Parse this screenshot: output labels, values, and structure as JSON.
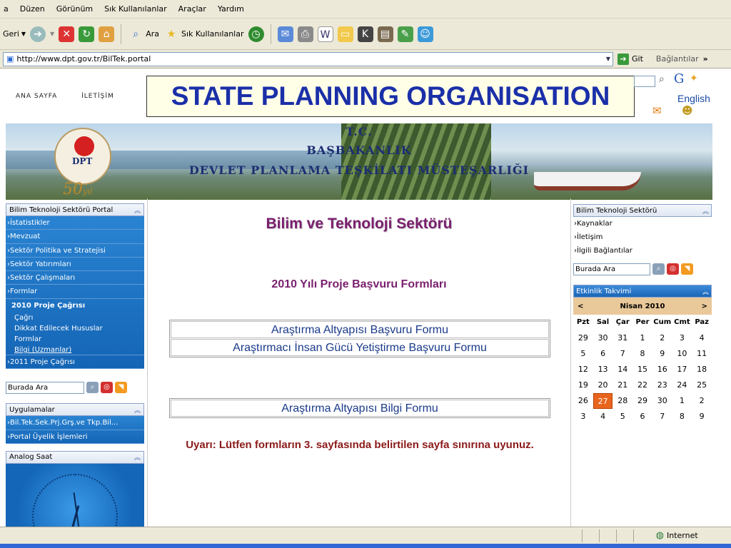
{
  "browser": {
    "menu": [
      "a",
      "Düzen",
      "Görünüm",
      "Sık Kullanılanlar",
      "Araçlar",
      "Yardım"
    ],
    "toolbar": {
      "back": "Geri",
      "search": "Ara",
      "favorites": "Sık Kullanılanlar"
    },
    "address": {
      "url": "http://www.dpt.gov.tr/BilTek.portal",
      "go": "Git",
      "links": "Bağlantılar"
    },
    "status": {
      "zone": "Internet"
    }
  },
  "page": {
    "toplinks": {
      "home": "ANA SAYFA",
      "contact": "İLETİŞİM"
    },
    "headline": "STATE PLANNING ORGANISATION",
    "english": "English",
    "banner": {
      "line1": "T.C.",
      "line2": "BAŞBAKANLIK",
      "line3": "DEVLET PLANLAMA TEŞKİLATI MÜSTEŞARLIĞI",
      "logo_text": "DPT",
      "anniv": "50",
      "anniv_suffix": "yıl"
    },
    "left": {
      "portal_title": "Bilim Teknoloji Sektörü Portal",
      "items": [
        "İstatistikler",
        "Mevzuat",
        "Sektör Politika ve Stratejisi",
        "Sektör Yatırımları",
        "Sektör Çalışmaları",
        "Formlar"
      ],
      "active": "2010 Proje Çağrısı",
      "subitems": [
        "Çağrı",
        "Dikkat Edilecek Hususlar",
        "Formlar",
        "Bilgi (Uzmanlar)"
      ],
      "next": "2011 Proje Çağrısı",
      "search_placeholder": "Burada Ara",
      "apps_title": "Uygulamalar",
      "apps": [
        "Bil.Tek.Sek.Prj.Grş.ve Tkp.Bil...",
        "Portal Üyelik İşlemleri"
      ],
      "clock_title": "Analog Saat"
    },
    "center": {
      "title": "Bilim ve Teknoloji Sektörü",
      "subtitle": "2010 Yılı Proje Başvuru Formları",
      "forms": [
        "Araştırma Altyapısı Başvuru Formu",
        "Araştırmacı İnsan Gücü Yetiştirme Başvuru Formu"
      ],
      "info_form": "Araştırma Altyapısı Bilgi Formu",
      "warning": "Uyarı: Lütfen formların 3. sayfasında belirtilen sayfa sınırına uyunuz."
    },
    "right": {
      "title": "Bilim Teknoloji Sektörü",
      "items": [
        "Kaynaklar",
        "İletişim",
        "İlgili Bağlantılar"
      ],
      "search_placeholder": "Burada Ara",
      "events_title": "Etkinlik Takvimi",
      "calendar": {
        "month": "Nisan 2010",
        "prev": "<",
        "next": ">",
        "days": [
          "Pzt",
          "Sal",
          "Çar",
          "Per",
          "Cum",
          "Cmt",
          "Paz"
        ],
        "weeks": [
          [
            "29",
            "30",
            "31",
            "1",
            "2",
            "3",
            "4"
          ],
          [
            "5",
            "6",
            "7",
            "8",
            "9",
            "10",
            "11"
          ],
          [
            "12",
            "13",
            "14",
            "15",
            "16",
            "17",
            "18"
          ],
          [
            "19",
            "20",
            "21",
            "22",
            "23",
            "24",
            "25"
          ],
          [
            "26",
            "27",
            "28",
            "29",
            "30",
            "1",
            "2"
          ],
          [
            "3",
            "4",
            "5",
            "6",
            "7",
            "8",
            "9"
          ]
        ],
        "today": "27"
      }
    }
  },
  "colors": {
    "headline": "#1a2fa8",
    "title": "#7a1f6e",
    "warning": "#8b1a1a",
    "nav": "#1a73c4",
    "today": "#e8651e"
  }
}
